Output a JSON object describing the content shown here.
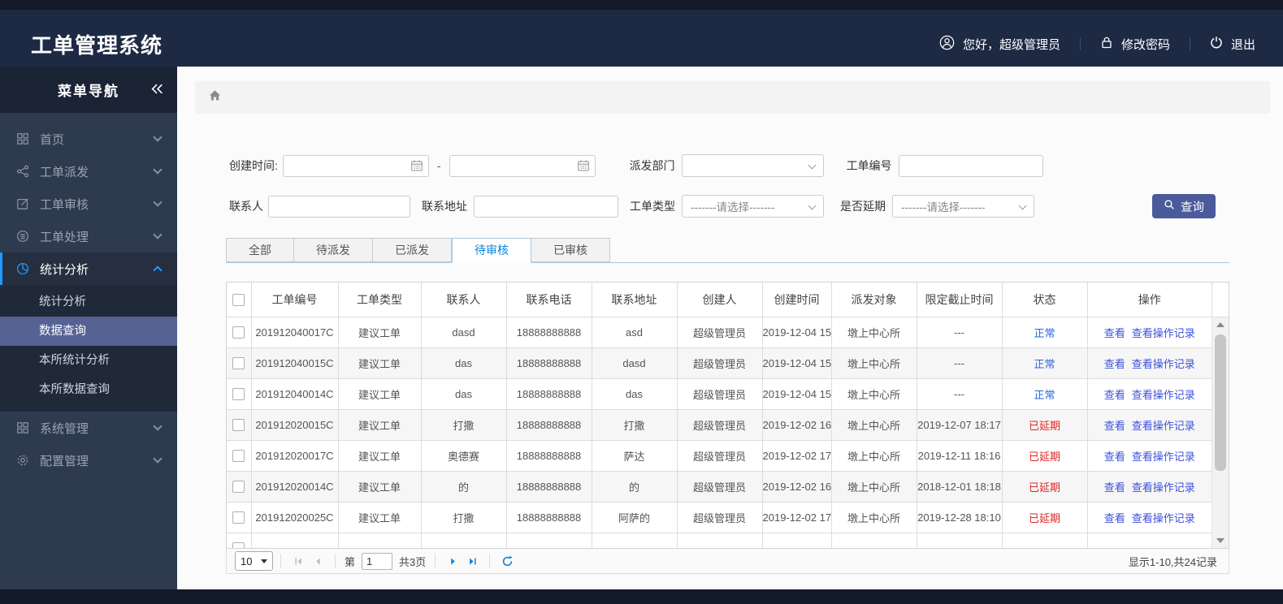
{
  "header": {
    "title": "工单管理系统",
    "greeting": "您好，超级管理员",
    "change_password": "修改密码",
    "logout": "退出"
  },
  "sidebar": {
    "title": "菜单导航",
    "items": [
      {
        "label": "首页",
        "icon": "grid",
        "expanded": false,
        "active": false
      },
      {
        "label": "工单派发",
        "icon": "share",
        "expanded": false,
        "active": false
      },
      {
        "label": "工单审核",
        "icon": "edit",
        "expanded": false,
        "active": false
      },
      {
        "label": "工单处理",
        "icon": "database",
        "expanded": false,
        "active": false
      },
      {
        "label": "统计分析",
        "icon": "pie-chart",
        "expanded": true,
        "active": true,
        "children": [
          {
            "label": "统计分析",
            "selected": false
          },
          {
            "label": "数据查询",
            "selected": true
          },
          {
            "label": "本所统计分析",
            "selected": false
          },
          {
            "label": "本所数据查询",
            "selected": false
          }
        ]
      },
      {
        "label": "系统管理",
        "icon": "grid",
        "expanded": false,
        "active": false
      },
      {
        "label": "配置管理",
        "icon": "gear",
        "expanded": false,
        "active": false
      }
    ]
  },
  "breadcrumb": {
    "icon": "home"
  },
  "filters": {
    "create_time_label": "创建时间:",
    "date_from_value": "",
    "date_separator": "-",
    "date_to_value": "",
    "dispatch_dept_label": "派发部门",
    "dispatch_dept_value": "",
    "order_no_label": "工单编号",
    "order_no_value": "",
    "contact_label": "联系人",
    "contact_value": "",
    "address_label": "联系地址",
    "address_value": "",
    "order_type_label": "工单类型",
    "order_type_value": "-------请选择-------",
    "delay_label": "是否延期",
    "delay_value": "-------请选择-------",
    "search_button": "查询"
  },
  "tabs": [
    {
      "label": "全部",
      "active": false
    },
    {
      "label": "待派发",
      "active": false
    },
    {
      "label": "已派发",
      "active": false
    },
    {
      "label": "待审核",
      "active": true
    },
    {
      "label": "已审核",
      "active": false
    }
  ],
  "table": {
    "columns": [
      "工单编号",
      "工单类型",
      "联系人",
      "联系电话",
      "联系地址",
      "创建人",
      "创建时间",
      "派发对象",
      "限定截止时间",
      "状态",
      "操作"
    ],
    "action_labels": [
      "查看",
      "查看操作记录"
    ],
    "status_colors": {
      "正常": "#2b64d8",
      "已延期": "#e02525"
    },
    "rows": [
      {
        "order_no": "201912040017C",
        "type": "建议工单",
        "contact": "dasd",
        "phone": "18888888888",
        "address": "asd",
        "creator": "超级管理员",
        "created": "2019-12-04 15",
        "target": "墩上中心所",
        "deadline": "---",
        "status": "正常"
      },
      {
        "order_no": "201912040015C",
        "type": "建议工单",
        "contact": "das",
        "phone": "18888888888",
        "address": "dasd",
        "creator": "超级管理员",
        "created": "2019-12-04 15",
        "target": "墩上中心所",
        "deadline": "---",
        "status": "正常"
      },
      {
        "order_no": "201912040014C",
        "type": "建议工单",
        "contact": "das",
        "phone": "18888888888",
        "address": "das",
        "creator": "超级管理员",
        "created": "2019-12-04 15",
        "target": "墩上中心所",
        "deadline": "---",
        "status": "正常"
      },
      {
        "order_no": "201912020015C",
        "type": "建议工单",
        "contact": "打撒",
        "phone": "18888888888",
        "address": "打撒",
        "creator": "超级管理员",
        "created": "2019-12-02 16",
        "target": "墩上中心所",
        "deadline": "2019-12-07 18:17",
        "status": "已延期"
      },
      {
        "order_no": "201912020017C",
        "type": "建议工单",
        "contact": "奥德赛",
        "phone": "18888888888",
        "address": "萨达",
        "creator": "超级管理员",
        "created": "2019-12-02 17",
        "target": "墩上中心所",
        "deadline": "2019-12-11 18:16",
        "status": "已延期"
      },
      {
        "order_no": "201912020014C",
        "type": "建议工单",
        "contact": "的",
        "phone": "18888888888",
        "address": "的",
        "creator": "超级管理员",
        "created": "2019-12-02 16",
        "target": "墩上中心所",
        "deadline": "2018-12-01 18:18",
        "status": "已延期"
      },
      {
        "order_no": "201912020025C",
        "type": "建议工单",
        "contact": "打撒",
        "phone": "18888888888",
        "address": "阿萨的",
        "creator": "超级管理员",
        "created": "2019-12-02 17",
        "target": "墩上中心所",
        "deadline": "2019-12-28 18:10",
        "status": "已延期"
      }
    ]
  },
  "pagination": {
    "page_size": "10",
    "page_label_prefix": "第",
    "current_page": "1",
    "total_pages_label": "共3页",
    "summary": "显示1-10,共24记录"
  },
  "colors": {
    "accent_blue": "#1f9aff",
    "search_button_bg": "#4a5a9b",
    "status_normal": "#2b64d8",
    "status_delayed": "#e02525",
    "action_link": "#3c50dd",
    "active_tab_text": "#0a85d9",
    "selected_menu_bg": "#566293"
  }
}
